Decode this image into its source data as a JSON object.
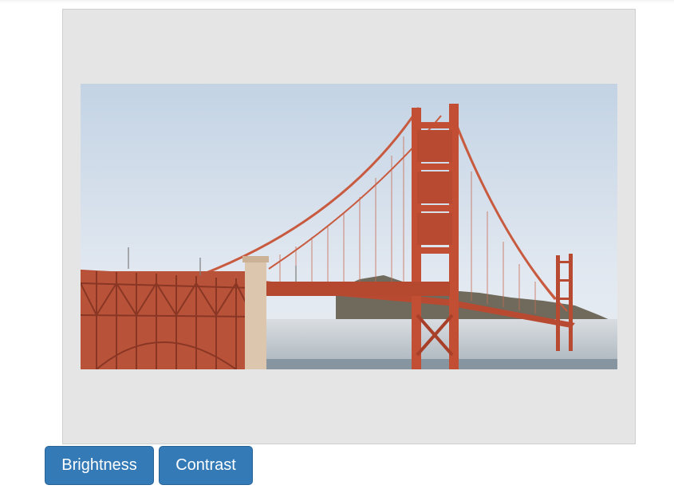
{
  "image": {
    "alt": "",
    "subject": "golden-gate-bridge-photo",
    "colors": {
      "sky_top": "#c9d7e6",
      "sky_bottom": "#e6ecf3",
      "bridge": "#c8553a",
      "bridge_dark": "#9c3b26",
      "fog": "#cfd6dc",
      "hills": "#6e6a5e",
      "water": "#8e9aa3",
      "pier": "#d9c2a9"
    }
  },
  "toolbar": {
    "brightness_label": "Brightness",
    "contrast_label": "Contrast"
  },
  "colors": {
    "frame_bg": "#e5e5e5",
    "button_bg": "#337ab7",
    "button_text": "#ffffff"
  }
}
